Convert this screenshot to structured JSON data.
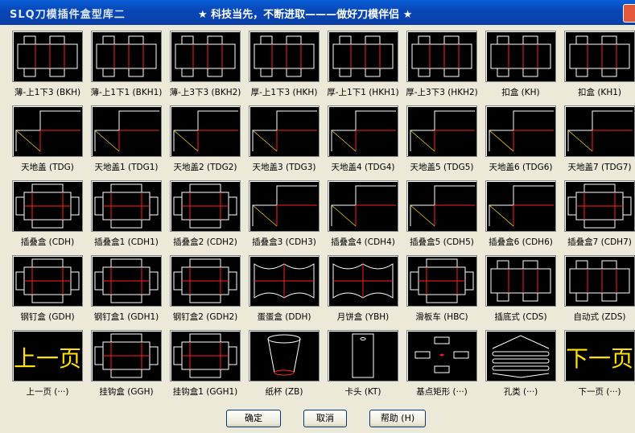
{
  "window": {
    "app_title": "SLQ刀模插件盒型库二",
    "slogan": "★ 科技当先，不断进取———做好刀模伴侣 ★"
  },
  "items": [
    {
      "label": "薄-上1下3 (BKH)",
      "kind": "tuck"
    },
    {
      "label": "薄-上1下1 (BKH1)",
      "kind": "tuck"
    },
    {
      "label": "薄-上3下3 (BKH2)",
      "kind": "tuck"
    },
    {
      "label": "厚-上1下3 (HKH)",
      "kind": "tuck"
    },
    {
      "label": "厚-上1下1 (HKH1)",
      "kind": "tuck"
    },
    {
      "label": "厚-上3下3 (HKH2)",
      "kind": "tuck"
    },
    {
      "label": "扣盒 (KH)",
      "kind": "tuck"
    },
    {
      "label": "扣盒 (KH1)",
      "kind": "tuck"
    },
    {
      "label": "天地盖 (TDG)",
      "kind": "lid"
    },
    {
      "label": "天地盖1 (TDG1)",
      "kind": "lid"
    },
    {
      "label": "天地盖2 (TDG2)",
      "kind": "lid"
    },
    {
      "label": "天地盖3 (TDG3)",
      "kind": "lid"
    },
    {
      "label": "天地盖4 (TDG4)",
      "kind": "lid"
    },
    {
      "label": "天地盖5 (TDG5)",
      "kind": "lid"
    },
    {
      "label": "天地盖6 (TDG6)",
      "kind": "lid"
    },
    {
      "label": "天地盖7 (TDG7)",
      "kind": "lid"
    },
    {
      "label": "插叠盒 (CDH)",
      "kind": "fold"
    },
    {
      "label": "插叠盒1 (CDH1)",
      "kind": "fold"
    },
    {
      "label": "插叠盒2 (CDH2)",
      "kind": "fold"
    },
    {
      "label": "插叠盒3 (CDH3)",
      "kind": "lid"
    },
    {
      "label": "插叠盒4 (CDH4)",
      "kind": "lid"
    },
    {
      "label": "插叠盒5 (CDH5)",
      "kind": "lid"
    },
    {
      "label": "插叠盒6 (CDH6)",
      "kind": "lid"
    },
    {
      "label": "插叠盒7 (CDH7)",
      "kind": "fold"
    },
    {
      "label": "钢钉盒 (GDH)",
      "kind": "fold"
    },
    {
      "label": "钢钉盒1 (GDH1)",
      "kind": "fold"
    },
    {
      "label": "钢钉盒2 (GDH2)",
      "kind": "fold"
    },
    {
      "label": "蛋蛋盒 (DDH)",
      "kind": "egg"
    },
    {
      "label": "月饼盒 (YBH)",
      "kind": "egg"
    },
    {
      "label": "滑板车 (HBC)",
      "kind": "fold"
    },
    {
      "label": "插底式 (CDS)",
      "kind": "tuck"
    },
    {
      "label": "自动式 (ZDS)",
      "kind": "tuck"
    },
    {
      "label": "上一页 (···)",
      "kind": "prev",
      "glyph": "上一页"
    },
    {
      "label": "挂钩盒 (GGH)",
      "kind": "fold"
    },
    {
      "label": "挂钩盒1 (GGH1)",
      "kind": "fold"
    },
    {
      "label": "纸杯 (ZB)",
      "kind": "cup"
    },
    {
      "label": "卡头 (KT)",
      "kind": "card"
    },
    {
      "label": "基点矩形 (···)",
      "kind": "points"
    },
    {
      "label": "孔类 (···)",
      "kind": "holes"
    },
    {
      "label": "下一页 (···)",
      "kind": "next",
      "glyph": "下一页"
    }
  ],
  "buttons": {
    "ok": "确定",
    "cancel": "取消",
    "help": "帮助 (H)"
  },
  "colors": {
    "cut": "#ffffff",
    "crease": "#ff2020",
    "nav_text": "#ffe000",
    "thumb_bg": "#000000"
  }
}
